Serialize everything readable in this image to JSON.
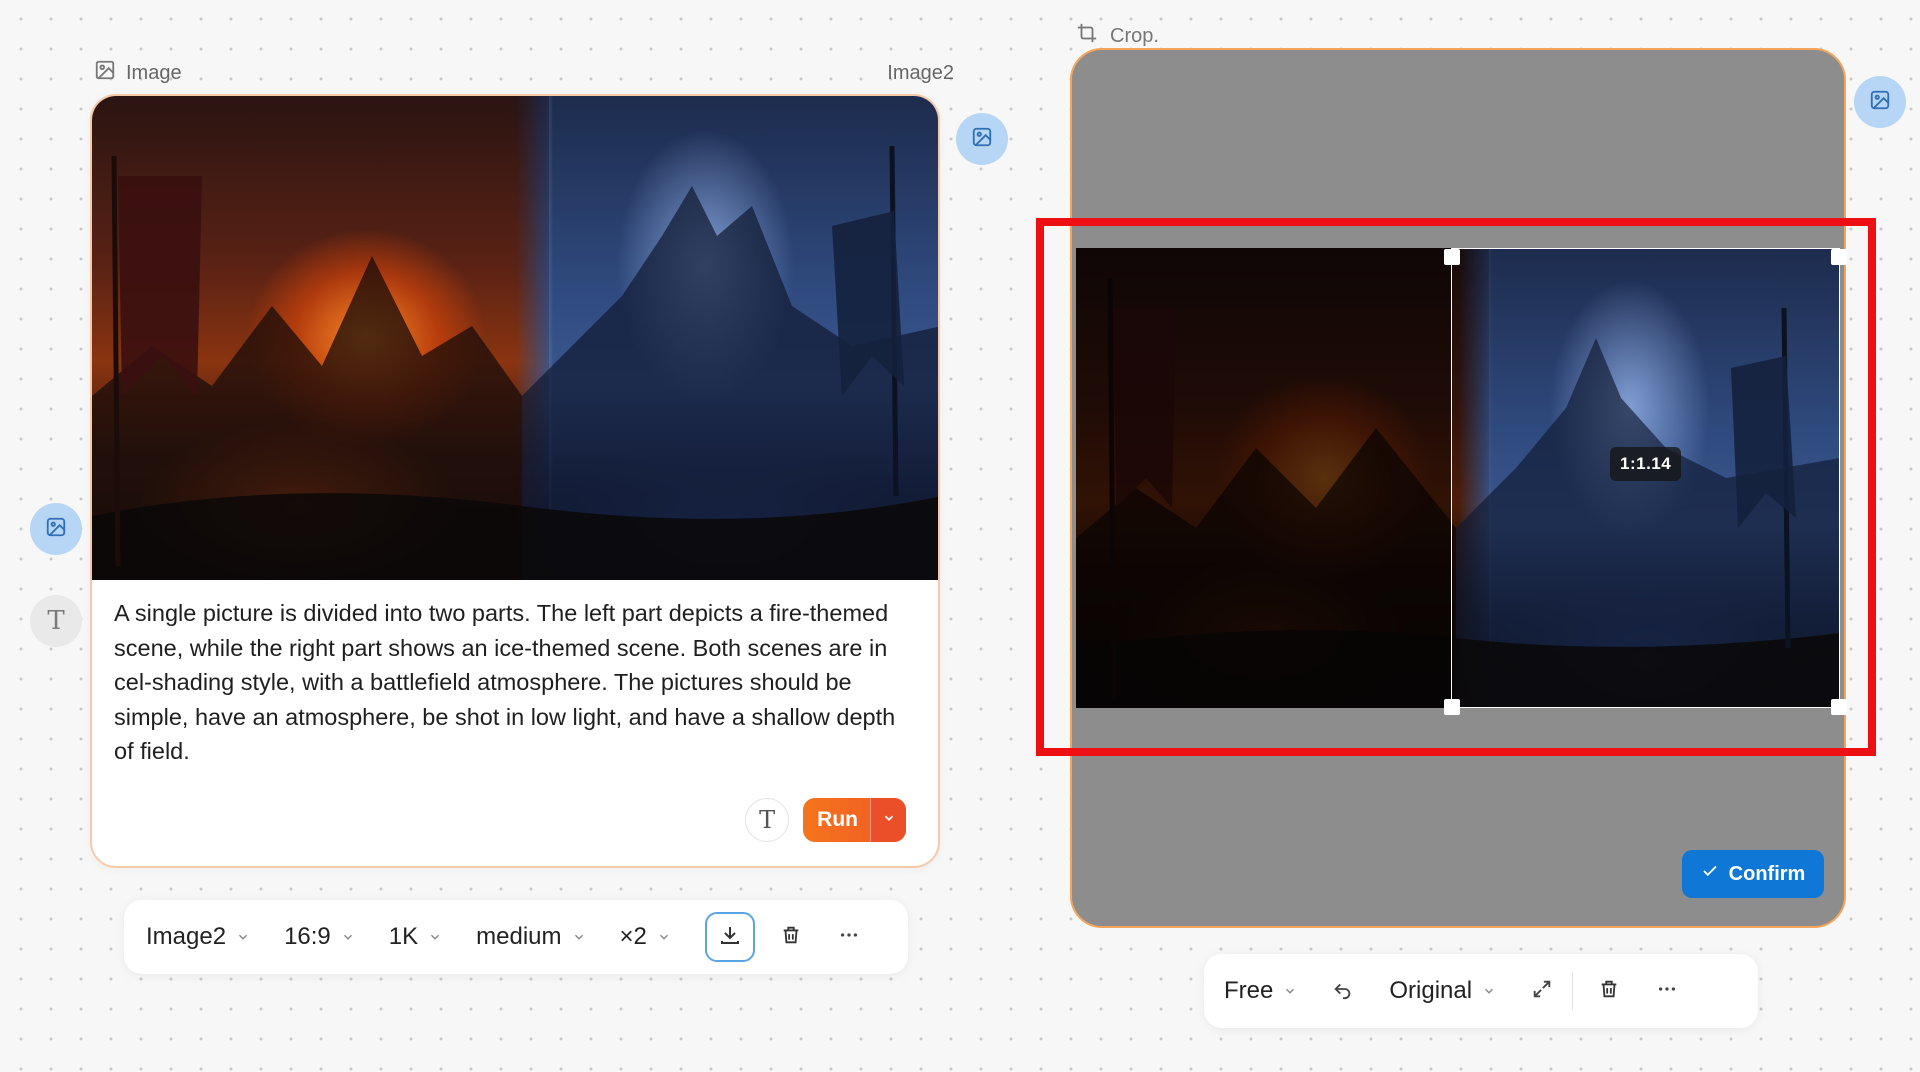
{
  "image_node": {
    "header_label": "Image",
    "model_name_label": "Image2",
    "prompt_text": "A single picture is divided into two parts. The left part depicts a fire-themed scene, while the right part shows an ice-themed scene. Both scenes are in cel-shading style, with a battlefield atmosphere. The pictures should be simple, have an atmosphere, be shot in low light, and have a shallow depth of field.",
    "run_label": "Run"
  },
  "image_toolbar": {
    "model": "Image2",
    "aspect_ratio": "16:9",
    "resolution": "1K",
    "quality": "medium",
    "count": "×2"
  },
  "crop_node": {
    "header_label": "Crop.",
    "ratio_label": "1:1.14",
    "confirm_label": "Confirm"
  },
  "crop_toolbar": {
    "mode": "Free",
    "preset": "Original"
  },
  "colors": {
    "accent_orange": "#f05a22",
    "confirm_blue": "#0f77d6",
    "highlight_red": "#ee0f14",
    "node_border": "#f6c9a9"
  },
  "icons": [
    "image-icon",
    "image-edit-icon",
    "text-icon",
    "chevron-down-icon",
    "download-icon",
    "trash-icon",
    "more-icon",
    "crop-icon",
    "check-icon",
    "undo-icon",
    "expand-icon"
  ]
}
